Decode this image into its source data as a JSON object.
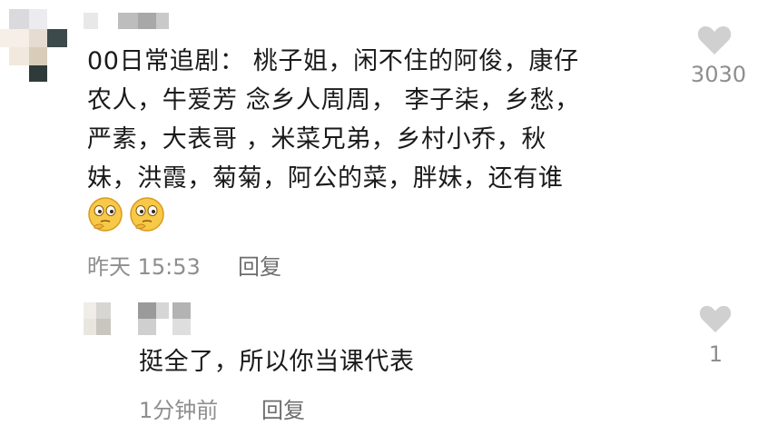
{
  "comment": {
    "lines": [
      "00日常追剧： 桃子姐，闲不住的阿俊，康仔",
      "农人，牛爱芳 念乡人周周， 李子柒，乡愁，",
      "严素，大表哥 ，米菜兄弟，乡村小乔，秋",
      "妹，洪霞，菊菊，阿公的菜，胖妹，还有谁"
    ],
    "emojis": [
      "thinking-face",
      "thinking-face"
    ],
    "timestamp": "昨天 15:53",
    "reply_label": "回复",
    "like_count": "3030",
    "like_icon": "heart-icon"
  },
  "reply": {
    "text": "挺全了，所以你当课代表",
    "timestamp": "1分钟前",
    "reply_label": "回复",
    "like_count": "1",
    "like_icon": "heart-icon"
  },
  "colors": {
    "text": "#1a1a1a",
    "meta": "#8e8e8e",
    "heart": "#d0d0d0"
  }
}
